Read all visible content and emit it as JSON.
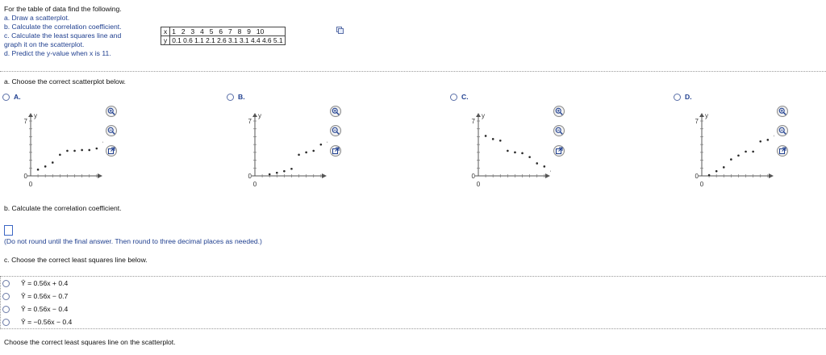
{
  "instructions": {
    "intro": "For the table of data find the following.",
    "a": "a. Draw a scatterplot.",
    "b": "b. Calculate the correlation coefficient.",
    "c1": "c. Calculate the least squares line and",
    "c2": "graph it on the scatterplot.",
    "d": "d. Predict the y-value when x is 11."
  },
  "table": {
    "x_label": "x",
    "y_label": "y",
    "x_values": "1   2   3   4   5   6   7   8   9   10",
    "y_values": "0.1 0.6 1.1 2.1 2.6 3.1 3.1 4.4 4.6 5.1"
  },
  "part_a": {
    "prompt": "a. Choose the correct scatterplot below.",
    "options": [
      {
        "label": "A.",
        "points": [
          [
            1,
            0.8
          ],
          [
            2,
            1.2
          ],
          [
            3,
            1.7
          ],
          [
            4,
            2.7
          ],
          [
            5,
            3.2
          ],
          [
            6,
            3.2
          ],
          [
            7,
            3.3
          ],
          [
            8,
            3.3
          ],
          [
            9,
            3.5
          ],
          [
            10,
            4.3
          ]
        ]
      },
      {
        "label": "B.",
        "points": [
          [
            2,
            0.2
          ],
          [
            3,
            0.4
          ],
          [
            4,
            0.6
          ],
          [
            5,
            0.9
          ],
          [
            6,
            2.7
          ],
          [
            7,
            3.0
          ],
          [
            8,
            3.2
          ],
          [
            9,
            4.0
          ],
          [
            10,
            4.3
          ],
          [
            11,
            5.1
          ]
        ]
      },
      {
        "label": "C.",
        "points": [
          [
            1,
            5.1
          ],
          [
            2,
            4.7
          ],
          [
            3,
            4.5
          ],
          [
            4,
            3.2
          ],
          [
            5,
            3.0
          ],
          [
            6,
            2.9
          ],
          [
            7,
            2.4
          ],
          [
            8,
            1.6
          ],
          [
            9,
            1.2
          ],
          [
            10,
            0.6
          ]
        ]
      },
      {
        "label": "D.",
        "points": [
          [
            1,
            0.1
          ],
          [
            2,
            0.6
          ],
          [
            3,
            1.1
          ],
          [
            4,
            2.1
          ],
          [
            5,
            2.6
          ],
          [
            6,
            3.1
          ],
          [
            7,
            3.1
          ],
          [
            8,
            4.4
          ],
          [
            9,
            4.6
          ],
          [
            10,
            5.1
          ]
        ]
      }
    ],
    "axis": {
      "y_label": "y",
      "x_label": "x",
      "y_tick": "7",
      "zero": "0",
      "x_origin": "0",
      "x_tick": "11",
      "xlim": [
        0,
        11
      ],
      "ylim": [
        0,
        7
      ]
    }
  },
  "part_b": {
    "prompt": "b. Calculate the correlation coefficient.",
    "note": "(Do not round until the final answer. Then round to three decimal places as needed.)"
  },
  "part_c": {
    "prompt": "c. Choose the correct least squares line below.",
    "options": [
      "Ŷ = 0.56x + 0.4",
      "Ŷ = 0.56x − 0.7",
      "Ŷ = 0.56x − 0.4",
      "Ŷ = −0.56x − 0.4"
    ]
  },
  "footer": {
    "prompt": "Choose the correct least squares line on the scatterplot."
  },
  "colors": {
    "accent": "#1f3f8f",
    "radio_border": "#5a6fa8",
    "box_border": "#3c66c4"
  }
}
